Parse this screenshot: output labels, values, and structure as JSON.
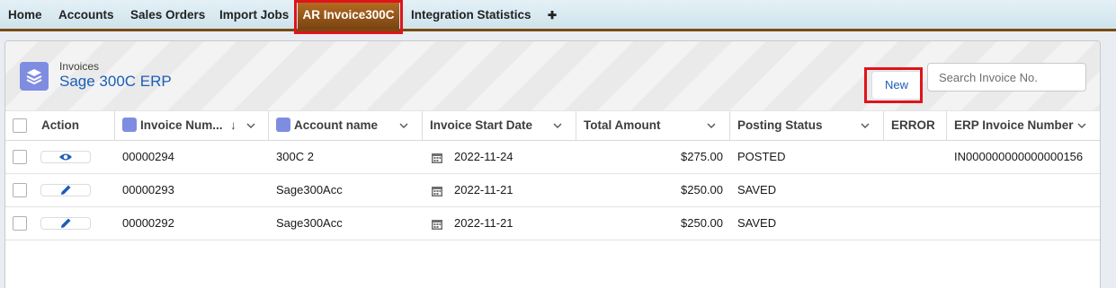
{
  "tabs": [
    {
      "label": "Home"
    },
    {
      "label": "Accounts"
    },
    {
      "label": "Sales Orders"
    },
    {
      "label": "Import Jobs"
    },
    {
      "label": "AR Invoice300C",
      "active": true
    },
    {
      "label": "Integration Statistics"
    },
    {
      "label": "✚"
    }
  ],
  "header": {
    "subtitle": "Invoices",
    "title": "Sage 300C ERP",
    "new_label": "New",
    "search_placeholder": "Search Invoice No."
  },
  "columns": {
    "action": "Action",
    "invoice_number": "Invoice Num...",
    "sort_arrow": "↓",
    "account_name": "Account name",
    "start_date": "Invoice Start Date",
    "total_amount": "Total Amount",
    "posting_status": "Posting Status",
    "error": "ERROR",
    "erp_invoice_number": "ERP Invoice Number"
  },
  "rows": [
    {
      "action_icon": "eye-icon",
      "invoice_number": "00000294",
      "account": "300C 2",
      "date": "2022-11-24",
      "amount": "$275.00",
      "status": "POSTED",
      "error": "",
      "erp": "IN000000000000000156"
    },
    {
      "action_icon": "pencil-icon",
      "invoice_number": "00000293",
      "account": "Sage300Acc",
      "date": "2022-11-21",
      "amount": "$250.00",
      "status": "SAVED",
      "error": "",
      "erp": ""
    },
    {
      "action_icon": "pencil-icon",
      "invoice_number": "00000292",
      "account": "Sage300Acc",
      "date": "2022-11-21",
      "amount": "$250.00",
      "status": "SAVED",
      "error": "",
      "erp": ""
    }
  ],
  "colors": {
    "active_tab": "#9a5a1c",
    "highlight": "#e0131a",
    "link": "#1b5eb8",
    "object_icon": "#7f8de1"
  }
}
